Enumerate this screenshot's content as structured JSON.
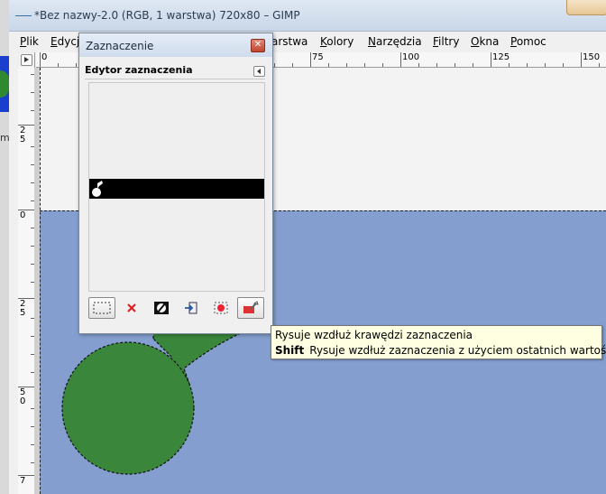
{
  "window": {
    "title": "*Bez nazwy-2.0 (RGB, 1 warstwa) 720x80 – GIMP"
  },
  "menubar": {
    "items": [
      {
        "label": "Plik",
        "underline": "P",
        "rest": "lik"
      },
      {
        "label": "Edycja",
        "underline": "E",
        "rest": "dycj"
      },
      {
        "label": "Warstwa",
        "underline": "",
        "rest": "arstwa"
      },
      {
        "label": "Kolory",
        "underline": "K",
        "rest": "olory"
      },
      {
        "label": "Narzędzia",
        "underline": "N",
        "rest": "arzędzia"
      },
      {
        "label": "Filtry",
        "underline": "F",
        "rest": "iltry"
      },
      {
        "label": "Okna",
        "underline": "O",
        "rest": "kna"
      },
      {
        "label": "Pomoc",
        "underline": "P",
        "rest": "omoc"
      }
    ]
  },
  "rulers": {
    "horizontal_labels": [
      "0",
      "75",
      "100",
      "125",
      "150"
    ],
    "vertical_labels": [
      "25",
      "0",
      "25",
      "50",
      "7"
    ]
  },
  "dialog": {
    "title": "Zaznaczenie",
    "heading": "Edytor zaznaczenia",
    "toolbar": [
      {
        "name": "select-all",
        "icon": "selection-rect-icon"
      },
      {
        "name": "select-none",
        "icon": "red-x-icon"
      },
      {
        "name": "invert",
        "icon": "invert-selection-icon"
      },
      {
        "name": "to-path",
        "icon": "to-path-icon"
      },
      {
        "name": "stroke-selection",
        "icon": "stroke-selection-icon"
      },
      {
        "name": "stroke-with-last",
        "icon": "paint-stroke-icon"
      }
    ]
  },
  "tooltip": {
    "line1": "Rysuje wzdłuż krawędzi zaznaczenia",
    "line2_key": "Shift",
    "line2_text": "Rysuje wzdłuż zaznaczenia z użyciem ostatnich wartości"
  },
  "background_window": {
    "fragment_text": "m"
  },
  "colors": {
    "canvas_blue": "#849fcf",
    "shape_green": "#3a863a",
    "selection_band": "#000000"
  }
}
